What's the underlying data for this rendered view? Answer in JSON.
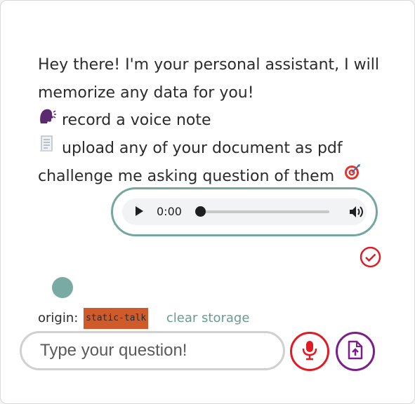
{
  "greeting": {
    "intro": "Hey there! I'm your personal assistant, I will memorize any data for you!",
    "line_voice": "record a voice note",
    "line_upload": "upload any of your document as pdf",
    "line_challenge": "challenge me asking question of them",
    "icons": [
      "speaking-head-icon",
      "document-icon",
      "target-icon"
    ]
  },
  "audio_player": {
    "time": "0:00",
    "progress": 0
  },
  "status": {
    "icon": "check-circle-icon",
    "color": "#e01b24"
  },
  "origin": {
    "label": "origin:",
    "tag": "static-talk",
    "clear_label": "clear storage"
  },
  "composer": {
    "placeholder": "Type your question!",
    "value": ""
  },
  "colors": {
    "accent_teal": "#74a79f",
    "mic_red": "#e01b24",
    "upload_purple": "#7b1e8a",
    "tag_orange": "#cf5a2a"
  }
}
